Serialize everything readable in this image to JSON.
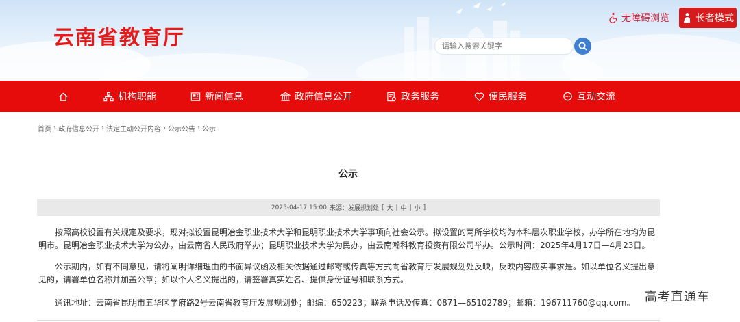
{
  "header": {
    "site_title": "云南省教育厅",
    "search_placeholder": "请输入搜索关键字",
    "accessibility_label": "无障碍浏览",
    "elder_mode_label": "长者模式",
    "accent_color": "#e60c0c"
  },
  "nav": {
    "items": [
      {
        "label": "",
        "icon": "home-icon"
      },
      {
        "label": "机构职能",
        "icon": "org-icon"
      },
      {
        "label": "新闻信息",
        "icon": "news-icon"
      },
      {
        "label": "政府信息公开",
        "icon": "building-icon"
      },
      {
        "label": "政务服务",
        "icon": "service-icon"
      },
      {
        "label": "便民服务",
        "icon": "heart-icon"
      },
      {
        "label": "互动交流",
        "icon": "chat-icon"
      }
    ]
  },
  "breadcrumb": {
    "items": [
      "首页",
      "政府信息公开",
      "法定主动公开内容",
      "公示公告",
      "公示"
    ],
    "separator": "›"
  },
  "article": {
    "title": "公示",
    "meta": {
      "datetime": "2025-04-17 15:00",
      "source": "来源：发展规划处",
      "font_open": "[",
      "font_large": "大",
      "font_medium": "中",
      "font_small": "小",
      "font_close": "]",
      "divider": "|"
    },
    "paragraphs": [
      "按照高校设置有关规定及要求，现对拟设置昆明冶金职业技术大学和昆明职业技术大学事项向社会公示。拟设置的两所学校均为本科层次职业学校，办学所在地均为昆明市。昆明冶金职业技术大学为公办，由云南省人民政府举办；昆明职业技术大学为民办，由云南瀚科教育投资有限公司举办。公示时间：2025年4月17日—4月23日。",
      "公示期内，如有不同意见，请将阐明详细理由的书面异议函及相关依据通过邮寄或传真等方式向省教育厅发展规划处反映，反映内容应实事求是。如以单位名义提出意见的，请署单位名称并加盖公章；如以个人名义提出的，请签署真实姓名、提供身份证号和联系方式。",
      "通讯地址：云南省昆明市五华区学府路2号云南省教育厅发展规划处；邮编：650223；联系电话及传真：0871—65102789；邮箱：196711760@qq.com。"
    ]
  },
  "watermark": "高考直通车"
}
